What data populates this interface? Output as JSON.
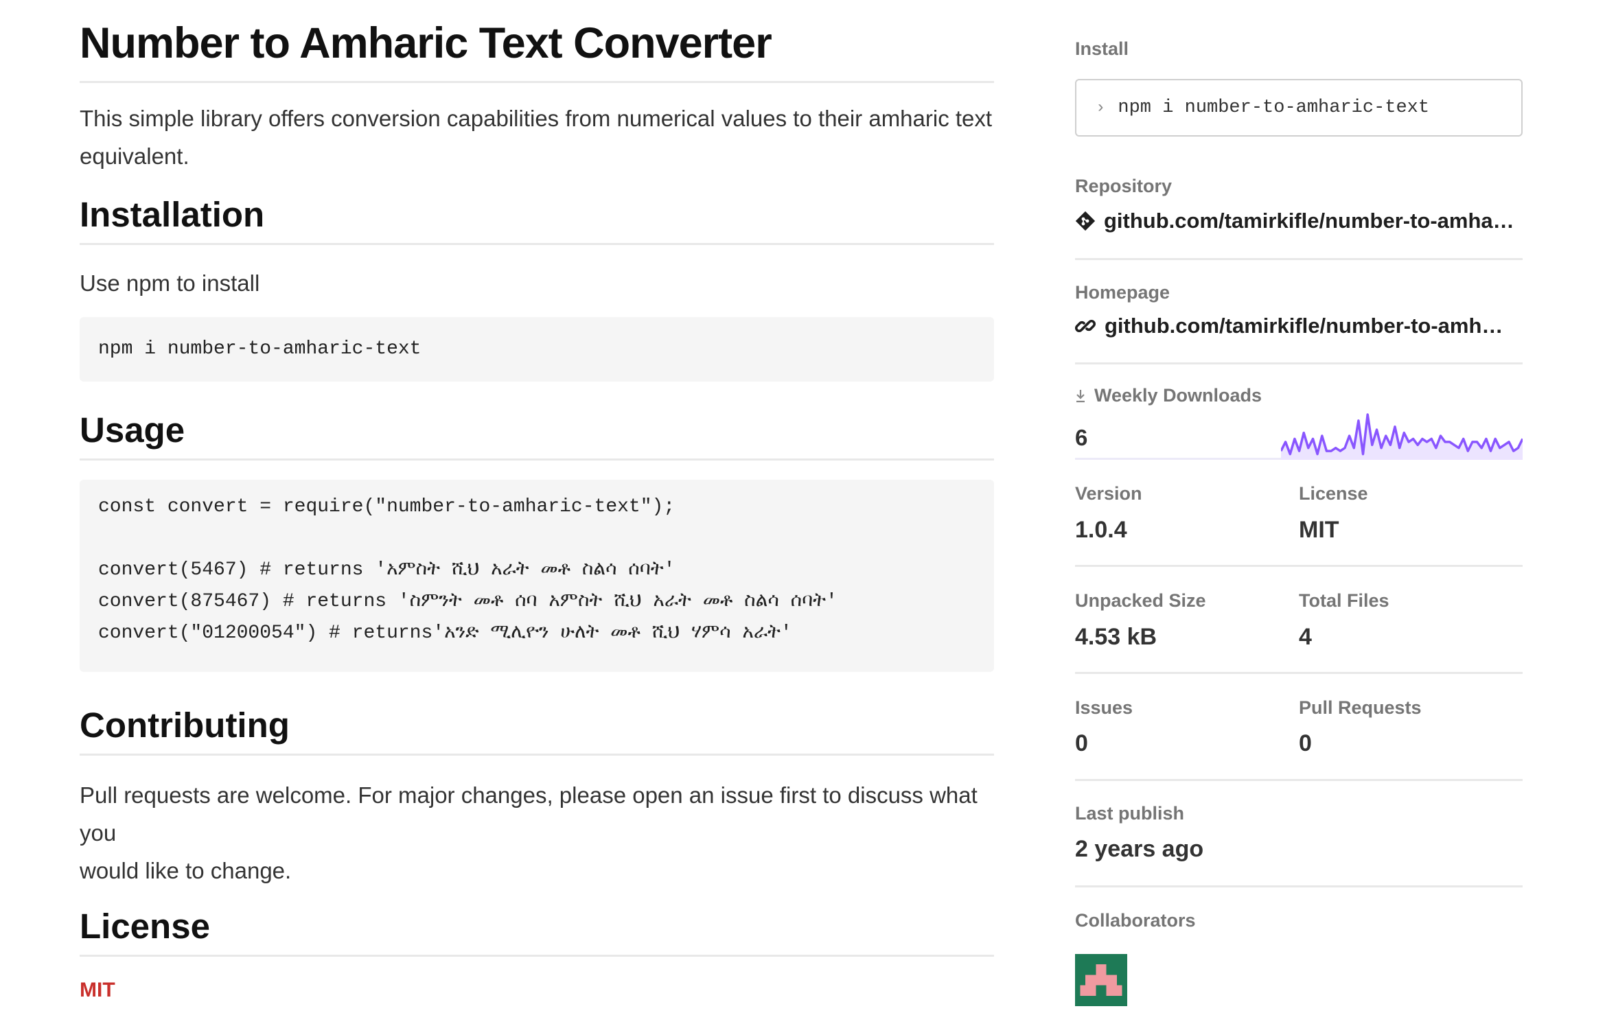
{
  "main": {
    "title": "Number to Amharic Text Converter",
    "intro": "This simple library offers conversion capabilities from numerical values to their amharic text",
    "intro_line2": "equivalent.",
    "installation": {
      "heading": "Installation",
      "text": "Use npm to install",
      "code": "npm i number-to-amharic-text"
    },
    "usage": {
      "heading": "Usage",
      "code_lines": [
        "const convert = require(\"number-to-amharic-text\");",
        "",
        "convert(5467) # returns 'አምስት ሺህ አራት መቶ ስልሳ ሰባት'",
        "convert(875467) # returns 'ስምንት መቶ ሰባ አምስት ሺህ አራት መቶ ስልሳ ሰባት'",
        "convert(\"01200054\") # returns'አንድ ሚሊዮን ሁለት መቶ ሺህ ሃምሳ አራት'"
      ]
    },
    "contributing": {
      "heading": "Contributing",
      "line1": "Pull requests are welcome. For major changes, please open an issue first to discuss what you",
      "line2": "would like to change."
    },
    "license": {
      "heading": "License",
      "value": "MIT"
    }
  },
  "sidebar": {
    "install_label": "Install",
    "install_prompt": "›",
    "install_cmd": "npm i number-to-amharic-text",
    "repository_label": "Repository",
    "repository_link": "github.com/tamirkifle/number-to-amharic-text",
    "homepage_label": "Homepage",
    "homepage_link": "github.com/tamirkifle/number-to-amharic-text",
    "weekly_downloads_label": "Weekly Downloads",
    "weekly_downloads": "6",
    "sparkline": [
      2,
      5,
      1,
      6,
      2,
      8,
      3,
      6,
      1,
      7,
      2,
      2,
      3,
      2,
      3,
      7,
      3,
      12,
      1,
      14,
      4,
      9,
      3,
      7,
      4,
      10,
      3,
      8,
      5,
      6,
      4,
      6,
      5,
      6,
      3,
      7,
      5,
      5,
      4,
      3,
      6,
      2,
      5,
      5,
      3,
      6,
      2,
      6,
      3,
      4,
      5,
      2,
      3,
      6
    ],
    "accent_color": "#8956ff",
    "version_label": "Version",
    "version": "1.0.4",
    "license_label": "License",
    "license": "MIT",
    "unpacked_size_label": "Unpacked Size",
    "unpacked_size": "4.53 kB",
    "total_files_label": "Total Files",
    "total_files": "4",
    "issues_label": "Issues",
    "issues": "0",
    "pull_requests_label": "Pull Requests",
    "pull_requests": "0",
    "last_publish_label": "Last publish",
    "last_publish": "2 years ago",
    "collaborators_label": "Collaborators"
  }
}
